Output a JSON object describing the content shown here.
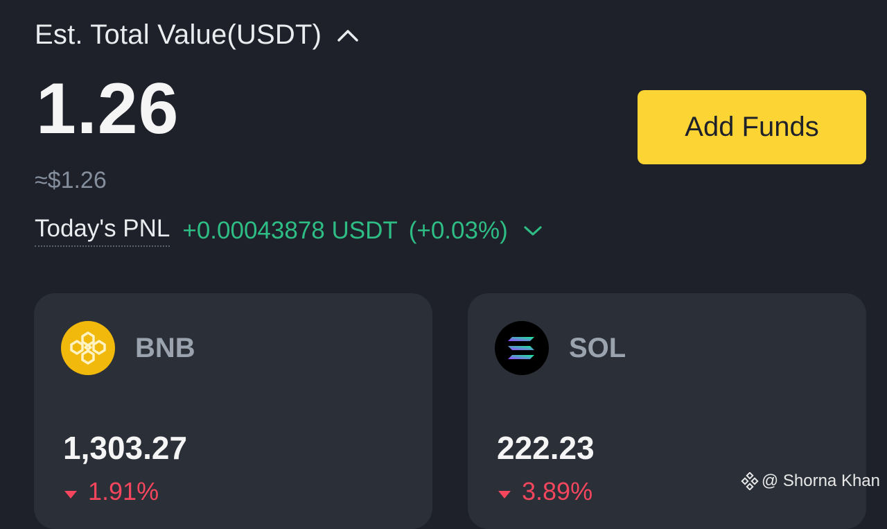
{
  "header": {
    "label": "Est. Total Value(USDT)",
    "toggle_icon": "chevron-up-icon",
    "total_value": "1.26",
    "approx_usd": "≈$1.26",
    "add_funds_label": "Add Funds"
  },
  "pnl": {
    "label": "Today's PNL",
    "value": "+0.00043878 USDT",
    "percent": "(+0.03%)",
    "toggle_icon": "chevron-down-icon"
  },
  "coins": [
    {
      "symbol": "BNB",
      "price": "1,303.27",
      "change": "1.91%",
      "direction": "down",
      "icon": "bnb-logo-icon"
    },
    {
      "symbol": "SOL",
      "price": "222.23",
      "change": "3.89%",
      "direction": "down",
      "icon": "sol-logo-icon"
    }
  ],
  "watermark": {
    "text": "@ Shorna Khan"
  },
  "colors": {
    "background": "#1e2129",
    "card": "#2b2f38",
    "accent_yellow": "#fcd535",
    "positive": "#2ebd85",
    "negative": "#f6465d",
    "muted": "#848e9c"
  }
}
